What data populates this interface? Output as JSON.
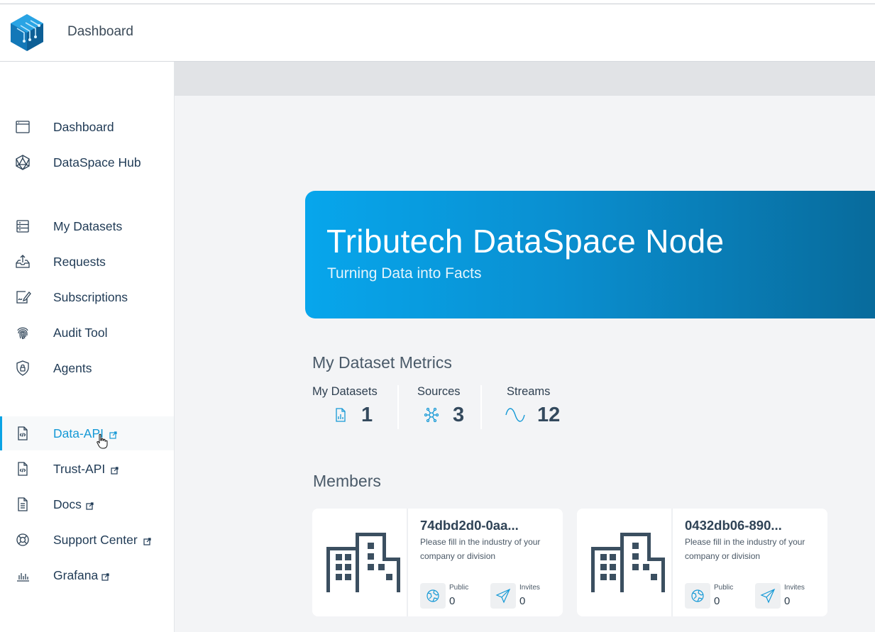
{
  "header": {
    "title": "Dashboard"
  },
  "sidebar": {
    "items": [
      {
        "label": "Dashboard",
        "icon": "window-icon",
        "external": false
      },
      {
        "label": "DataSpace Hub",
        "icon": "polyhedron-icon",
        "external": false
      },
      {
        "label": "My Datasets",
        "icon": "server-stack-icon",
        "external": false
      },
      {
        "label": "Requests",
        "icon": "inbox-upload-icon",
        "external": false
      },
      {
        "label": "Subscriptions",
        "icon": "signature-document-icon",
        "external": false
      },
      {
        "label": "Audit Tool",
        "icon": "fingerprint-icon",
        "external": false
      },
      {
        "label": "Agents",
        "icon": "shield-lock-icon",
        "external": false
      },
      {
        "label": "Data-API",
        "icon": "code-file-icon",
        "external": true,
        "active": true
      },
      {
        "label": "Trust-API",
        "icon": "code-file-icon",
        "external": true
      },
      {
        "label": "Docs",
        "icon": "document-icon",
        "external": true
      },
      {
        "label": "Support Center",
        "icon": "lifebuoy-icon",
        "external": true
      },
      {
        "label": "Grafana",
        "icon": "bar-chart-icon",
        "external": true
      }
    ]
  },
  "hero": {
    "title": "Tributech DataSpace Node",
    "subtitle": "Turning Data into Facts"
  },
  "metrics": {
    "title": "My Dataset Metrics",
    "items": [
      {
        "label": "My Datasets",
        "value": "1",
        "icon": "chart-file-icon"
      },
      {
        "label": "Sources",
        "value": "3",
        "icon": "network-nodes-icon"
      },
      {
        "label": "Streams",
        "value": "12",
        "icon": "sine-wave-icon"
      }
    ]
  },
  "members": {
    "title": "Members",
    "cards": [
      {
        "name": "74dbd2d0-0aa...",
        "description": "Please fill in the industry of your company or division",
        "public_label": "Public",
        "public_value": "0",
        "invites_label": "Invites",
        "invites_value": "0"
      },
      {
        "name": "0432db06-890...",
        "description": "Please fill in the industry of your company or division",
        "public_label": "Public",
        "public_value": "0",
        "invites_label": "Invites",
        "invites_value": "0"
      }
    ]
  },
  "colors": {
    "accent": "#0aa3e4",
    "nav_text": "#1f3a55",
    "hero_start": "#07a6ec",
    "hero_end": "#086b9c"
  }
}
